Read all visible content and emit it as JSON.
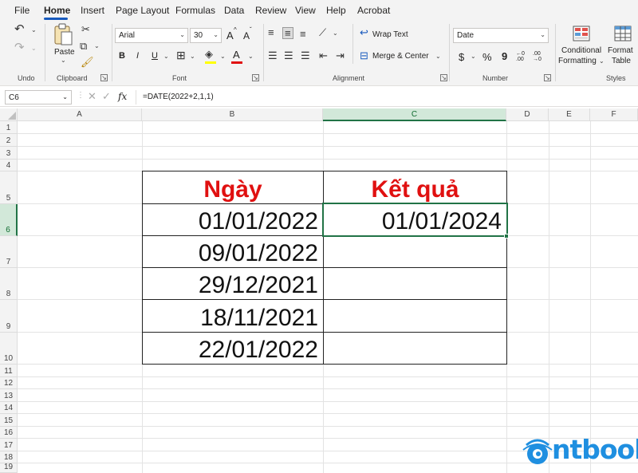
{
  "menu": {
    "items": [
      "File",
      "Home",
      "Insert",
      "Page Layout",
      "Formulas",
      "Data",
      "Review",
      "View",
      "Help",
      "Acrobat"
    ],
    "active": "Home"
  },
  "ribbon": {
    "groups": {
      "undo": "Undo",
      "clipboard": "Clipboard",
      "font": "Font",
      "alignment": "Alignment",
      "number": "Number",
      "styles": "Styles"
    },
    "paste_label": "Paste",
    "font_name": "Arial",
    "font_size": "30",
    "wrap_text": "Wrap Text",
    "merge_center": "Merge & Center",
    "number_format": "Date",
    "conditional_formatting_line1": "Conditional",
    "conditional_formatting_line2": "Formatting",
    "format_table_line1": "Format",
    "format_table_line2": "Table",
    "bold": "B",
    "italic": "I",
    "underline": "U",
    "currency": "$",
    "percent": "%",
    "comma": "9",
    "font_color_letter": "A",
    "grow_font": "A",
    "shrink_font": "A",
    "inc_decimal": "←0 .00",
    "dec_decimal": ".00 →0",
    "accent_color": "#185abd",
    "font_color_bar": "#e01010",
    "fill_color_bar": "#ffff00"
  },
  "formula_bar": {
    "name_box": "C6",
    "fx": "fx",
    "formula": "=DATE(2022+2,1,1)"
  },
  "grid": {
    "columns": [
      "A",
      "B",
      "C",
      "D",
      "E",
      "F"
    ],
    "selected_column": "C",
    "rows": [
      "1",
      "2",
      "3",
      "4",
      "5",
      "6",
      "7",
      "8",
      "9",
      "10",
      "11",
      "12",
      "13",
      "14",
      "15",
      "16",
      "17",
      "18",
      "19"
    ],
    "selected_row": "6"
  },
  "table": {
    "header_date": "Ngày",
    "header_result": "Kết quả",
    "dates": [
      "01/01/2022",
      "09/01/2022",
      "29/12/2021",
      "18/11/2021",
      "22/01/2022"
    ],
    "results": [
      "01/01/2024",
      "",
      "",
      "",
      ""
    ],
    "header_color": "#e01010"
  },
  "logo": {
    "text": "ntbook",
    "color": "#1f8fe0"
  }
}
